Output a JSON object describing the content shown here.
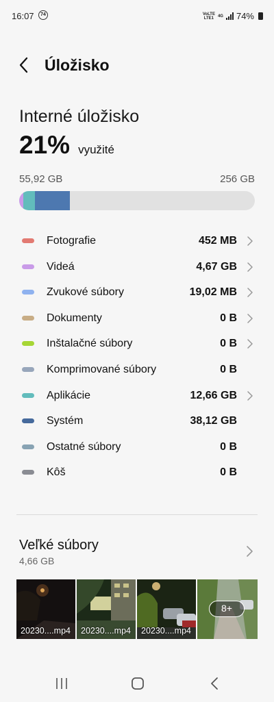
{
  "status": {
    "time": "16:07",
    "notification": "74",
    "volte_top": "VoLTE",
    "volte_bottom": "LTE1",
    "network": "4G",
    "battery": "74%"
  },
  "header": {
    "title": "Úložisko"
  },
  "storage": {
    "title": "Interné úložisko",
    "used_percent": "21%",
    "used_label": "využité",
    "used_size": "55,92 GB",
    "total_size": "256 GB",
    "usage_segments": [
      {
        "color": "#c99be8",
        "fraction": 0.018
      },
      {
        "color": "#62bcbc",
        "fraction": 0.049
      },
      {
        "color": "#4d78b0",
        "fraction": 0.149
      }
    ],
    "bar_background": "#e1e1e1"
  },
  "categories": [
    {
      "label": "Fotografie",
      "size": "452 MB",
      "color": "#e27a72",
      "chevron": true
    },
    {
      "label": "Videá",
      "size": "4,67 GB",
      "color": "#c99be8",
      "chevron": true
    },
    {
      "label": "Zvukové súbory",
      "size": "19,02 MB",
      "color": "#8fb2ef",
      "chevron": true
    },
    {
      "label": "Dokumenty",
      "size": "0 B",
      "color": "#c8ad86",
      "chevron": true
    },
    {
      "label": "Inštalačné súbory",
      "size": "0 B",
      "color": "#a6d635",
      "chevron": true
    },
    {
      "label": "Komprimované súbory",
      "size": "0 B",
      "color": "#98a6bb",
      "chevron": false
    },
    {
      "label": "Aplikácie",
      "size": "12,66 GB",
      "color": "#62bcbc",
      "chevron": true
    },
    {
      "label": "Systém",
      "size": "38,12 GB",
      "color": "#466a9c",
      "chevron": false
    },
    {
      "label": "Ostatné súbory",
      "size": "0 B",
      "color": "#88a3b3",
      "chevron": false
    },
    {
      "label": "Kôš",
      "size": "0 B",
      "color": "#8a8c93",
      "chevron": false
    }
  ],
  "large_files": {
    "title": "Veľké súbory",
    "size": "4,66 GB",
    "thumbnails": [
      {
        "name": "20230....mp4",
        "scene": "night-street"
      },
      {
        "name": "20230....mp4",
        "scene": "building"
      },
      {
        "name": "20230....mp4",
        "scene": "cars"
      },
      {
        "name": "",
        "scene": "path",
        "more": "8+"
      }
    ]
  },
  "navbar": {
    "recents_icon": "recents-icon",
    "home_icon": "home-icon",
    "back_icon": "back-icon"
  }
}
